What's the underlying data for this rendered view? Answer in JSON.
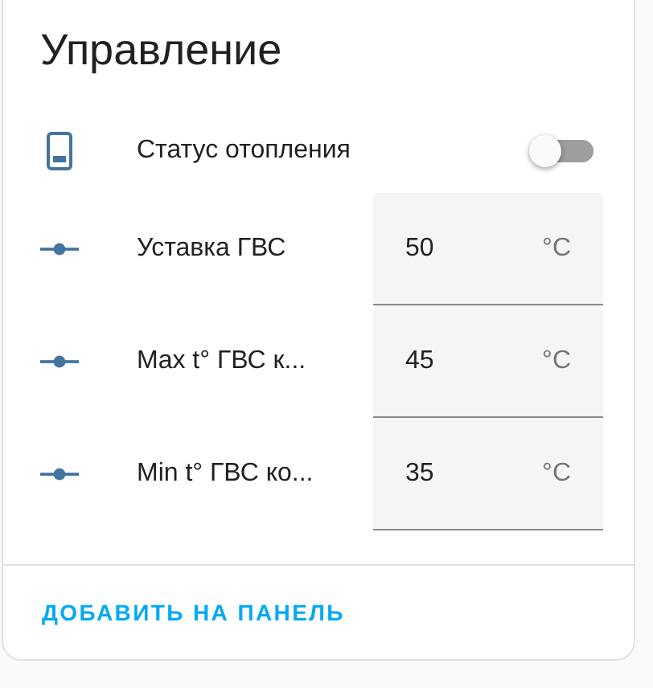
{
  "card": {
    "title": "Управление",
    "entities": [
      {
        "kind": "toggle",
        "name": "Статус отопления",
        "on": false
      },
      {
        "kind": "number",
        "name": "Уставка ГВС",
        "value": "50",
        "unit": "°C"
      },
      {
        "kind": "number",
        "name": "Max t° ГВС к...",
        "value": "45",
        "unit": "°C"
      },
      {
        "kind": "number",
        "name": "Min t° ГВС ко...",
        "value": "35",
        "unit": "°C"
      }
    ],
    "action": "ДОБАВИТЬ НА ПАНЕЛЬ"
  }
}
